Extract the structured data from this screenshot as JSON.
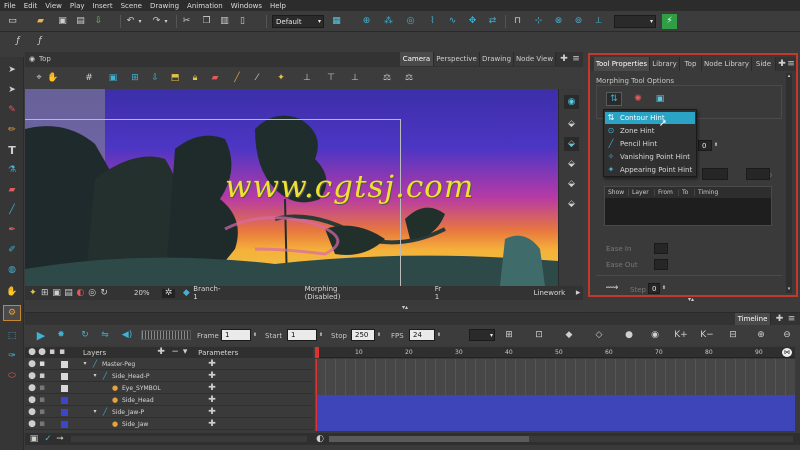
{
  "menu": [
    "File",
    "Edit",
    "View",
    "Play",
    "Insert",
    "Scene",
    "Drawing",
    "Animation",
    "Windows",
    "Help"
  ],
  "toolbar": {
    "workspace_value": "Default"
  },
  "view_tabs": [
    "Camera",
    "Perspective",
    "Drawing",
    "Node View"
  ],
  "view_title": "Top",
  "right_tabs": [
    "Tool Properties",
    "Library",
    "Top",
    "Node Library",
    "Side"
  ],
  "tool_properties": {
    "section_title": "Morphing Tool Options",
    "dropdown_items": [
      "Contour Hint",
      "Zone Hint",
      "Pencil Hint",
      "Vanishing Point Hint",
      "Appearing Point Hint"
    ],
    "selected_index": 0,
    "table_headers": [
      "Show",
      "Layer",
      "From",
      "To",
      "Timing"
    ],
    "ease_in_label": "Ease In",
    "ease_out_label": "Ease Out",
    "step_label": "Step",
    "field_value": "0"
  },
  "status_bar": {
    "zoom": "20%",
    "branch": "Branch-1",
    "morphing": "Morphing (Disabled)",
    "frame": "Fr 1",
    "mode": "Linework"
  },
  "watermark": "www.cgtsj.com",
  "timeline": {
    "title": "Timeline",
    "frame_label": "Frame",
    "frame_value": "1",
    "start_label": "Start",
    "start_value": "1",
    "stop_label": "Stop",
    "stop_value": "250",
    "fps_label": "FPS",
    "fps_value": "24",
    "layers_header": "Layers",
    "params_header": "Parameters",
    "ruler": [
      "10",
      "20",
      "30",
      "40",
      "50",
      "60",
      "70",
      "80",
      "90"
    ],
    "layers": [
      {
        "name": "Master-Peg",
        "indent": 0
      },
      {
        "name": "Side_Head-P",
        "indent": 1
      },
      {
        "name": "Eye_SYMBOL",
        "indent": 2
      },
      {
        "name": "Side_Head",
        "indent": 2
      },
      {
        "name": "Side_Jaw-P",
        "indent": 1
      },
      {
        "name": "Side_Jaw",
        "indent": 2
      }
    ]
  },
  "colors": {
    "accent": "#2aa3c5",
    "highlight_border": "#c0392b",
    "layer_blue": "#3c46c9",
    "timeline_track": "#3d45b8"
  }
}
